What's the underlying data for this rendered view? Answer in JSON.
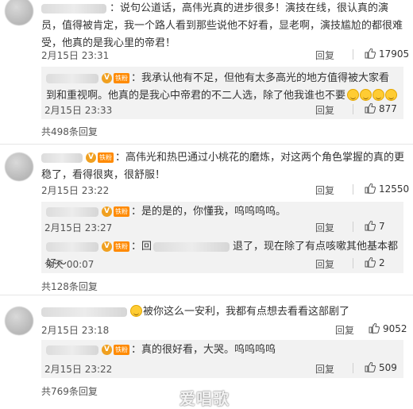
{
  "thread": {
    "reply_label": "回复",
    "comments": [
      {
        "text": "：说句公道话，高伟光真的进步很多！演技在线，很认真的演员，值得被肯定，我一个路人看到那些说他不好看，显老啊，演技尴尬的都很难受，他真的是我心里的帝君！",
        "time": "2月15日 23:31",
        "likes": "17905",
        "subs": [
          {
            "text": "：我承认他有不足，但他有太多高光的地方值得被大家看到和重视啊。他真的是我心中帝君的不二人选，除了他我谁也不要",
            "time": "2月15日 23:33",
            "likes": "877"
          }
        ],
        "more": "共498条回复"
      },
      {
        "text": "：高伟光和热巴通过小桃花的磨炼，对这两个角色掌握的真的更稳了，看得很爽，很舒服！",
        "time": "2月15日 23:22",
        "likes": "12550",
        "subs": [
          {
            "text": "：是的是的，你懂我，呜呜呜呜。",
            "time": "2月15日 23:27",
            "likes": "7"
          },
          {
            "text_prefix": "：回",
            "text_suffix": "退了，现在除了有点咳嗽其他基本都好～",
            "time": "今天 00:07",
            "likes": "2"
          }
        ],
        "more": "共128条回复"
      },
      {
        "text": "被你这么一安利，我都有点想去看看这部剧了",
        "time": "2月15日 23:18",
        "likes": "9052",
        "subs": [
          {
            "text": "：真的很好看，大哭。呜呜呜呜",
            "time": "2月15日 23:22",
            "likes": "509"
          }
        ],
        "more": "共769条回复"
      }
    ]
  },
  "watermark": "爱唱歌",
  "colors": {
    "badge": "#f0a020",
    "tag": "#ff8a00",
    "subbg": "#f2f2f2"
  },
  "icons": [
    "thumbs-up-icon",
    "verified-badge-icon",
    "crying-emoji-icon",
    "grinning-emoji-icon"
  ]
}
